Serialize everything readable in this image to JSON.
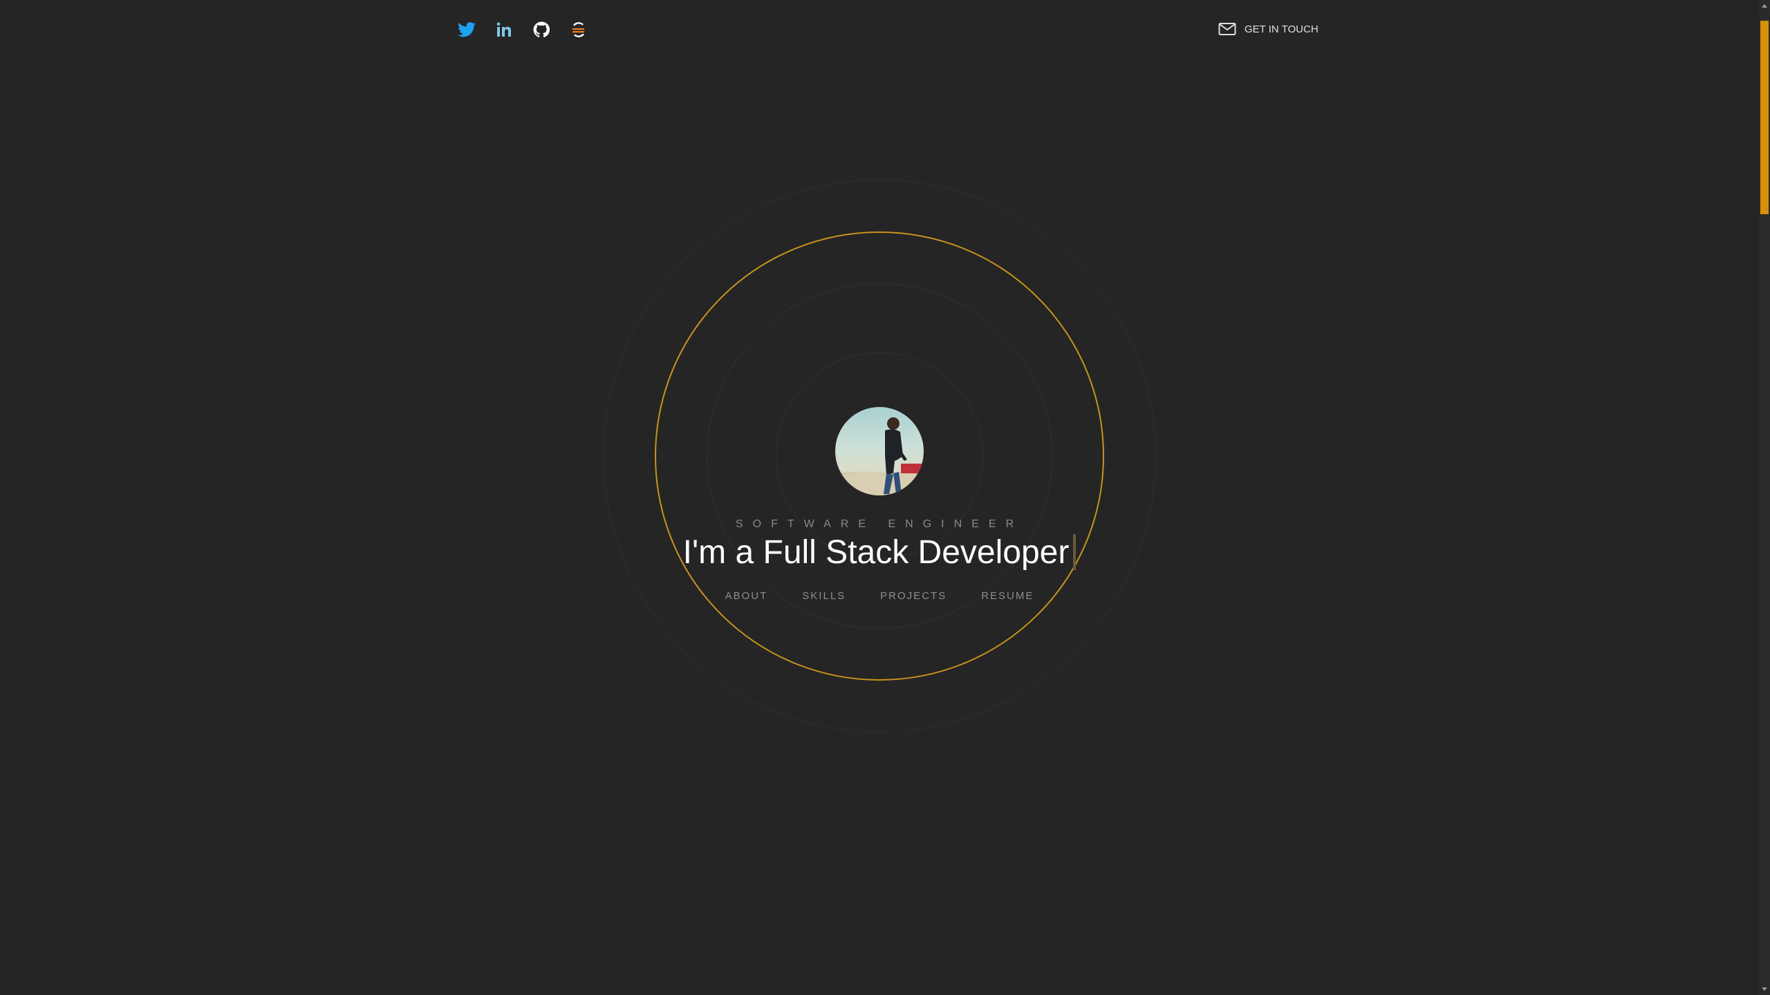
{
  "header": {
    "social": [
      {
        "icon": "twitter-icon",
        "color": "#1da1f2"
      },
      {
        "icon": "linkedin-icon",
        "color": "#7fc8e8"
      },
      {
        "icon": "github-icon",
        "color": "#ffffff"
      },
      {
        "icon": "stackoverflow-icon",
        "color": "#f48024"
      }
    ],
    "contact_label": "GET IN TOUCH"
  },
  "hero": {
    "role": "SOFTWARE ENGINEER",
    "headline": "I'm a Full Stack Developer",
    "nav": [
      {
        "label": "ABOUT"
      },
      {
        "label": "SKILLS"
      },
      {
        "label": "PROJECTS"
      },
      {
        "label": "RESUME"
      }
    ]
  },
  "colors": {
    "background": "#252525",
    "accent": "#c8941c",
    "scroll_thumb": "#d6900e"
  }
}
